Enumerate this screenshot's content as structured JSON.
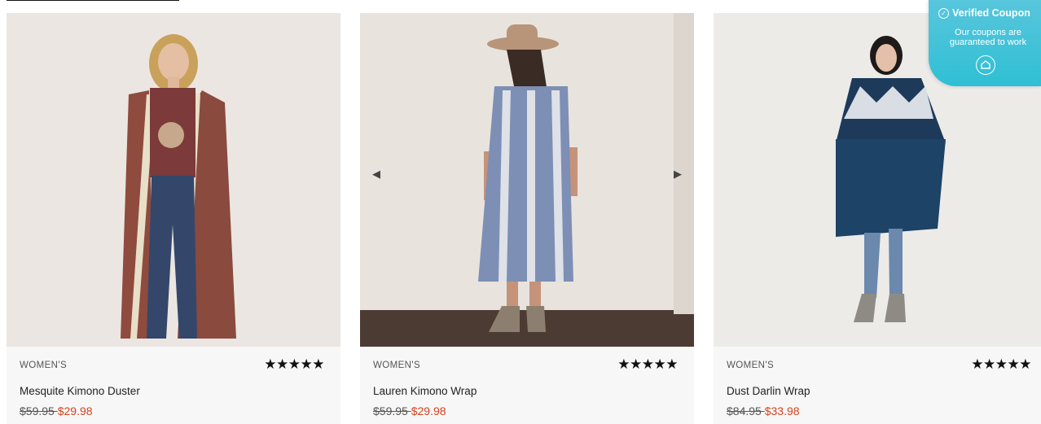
{
  "products": [
    {
      "category": "WOMEN'S",
      "rating_stars": "★★★★★",
      "rating": 5,
      "name": "Mesquite Kimono Duster",
      "old_price": "$59.95 ",
      "sale_price": "$29.98"
    },
    {
      "category": "WOMEN'S",
      "rating_stars": "★★★★★",
      "rating": 5,
      "name": "Lauren Kimono Wrap",
      "old_price": "$59.95 ",
      "sale_price": "$29.98"
    },
    {
      "category": "WOMEN'S",
      "rating_stars": "★★★★★",
      "rating": 5,
      "name": "Dust Darlin Wrap",
      "old_price": "$84.95 ",
      "sale_price": "$33.98"
    }
  ],
  "carousel": {
    "prev": "◀",
    "next": "▶"
  },
  "coupon": {
    "title": "Verified Coupon",
    "subtitle": "Our coupons are guaranteed to work",
    "check": "✓"
  },
  "colors": {
    "sale_price": "#d4421c",
    "coupon_bg": "#3fc3d8",
    "card_bg": "#f7f7f7"
  }
}
